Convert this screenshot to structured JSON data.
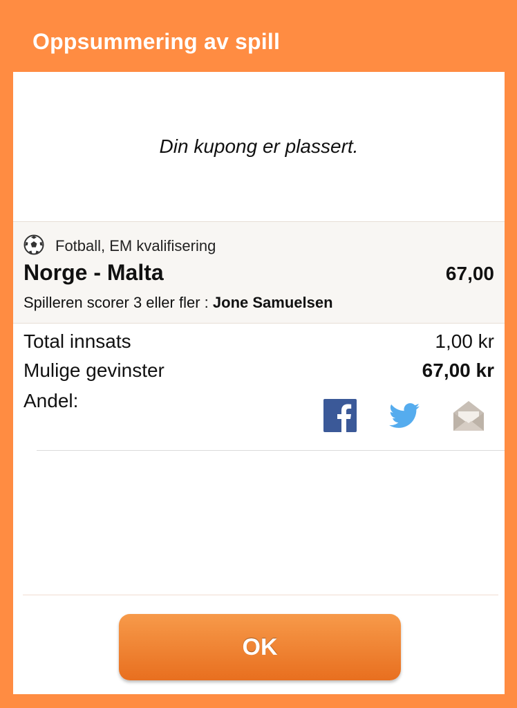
{
  "header": {
    "title": "Oppsummering av spill"
  },
  "confirmation": {
    "message": "Din kupong er plassert."
  },
  "bet": {
    "sport_icon": "soccer-ball-icon",
    "sport": "Fotball, EM kvalifisering",
    "match": "Norge - Malta",
    "odds": "67,00",
    "market": "Spilleren scorer 3 eller fler :",
    "selection": "Jone Samuelsen"
  },
  "summary": {
    "stake_label": "Total innsats",
    "stake_value": "1,00 kr",
    "winnings_label": "Mulige gevinster",
    "winnings_value": "67,00 kr",
    "share_label": "Andel:"
  },
  "share": {
    "icons": [
      "facebook-icon",
      "twitter-icon",
      "email-icon"
    ],
    "colors": {
      "facebook": "#3B5998",
      "twitter": "#55ACEE",
      "email": "#C8BFB6"
    }
  },
  "actions": {
    "ok_label": "OK"
  },
  "colors": {
    "accent": "#FF8C42",
    "button": "#EF7D2E"
  }
}
